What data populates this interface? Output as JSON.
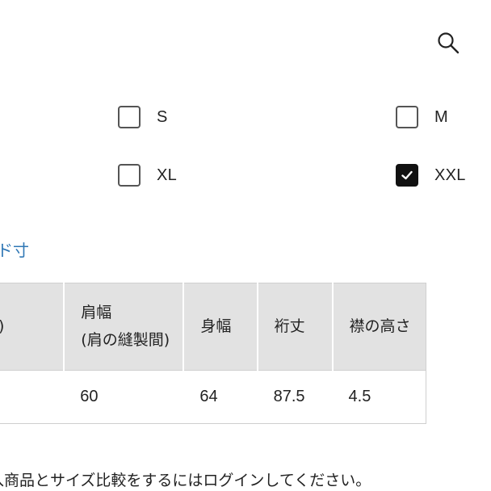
{
  "header": {
    "search_icon": "search-icon"
  },
  "size_options": [
    {
      "label": "S",
      "checked": false
    },
    {
      "label": "M",
      "checked": false
    },
    {
      "label": "XL",
      "checked": false
    },
    {
      "label": "XXL",
      "checked": true
    }
  ],
  "size_link": {
    "label": "ド寸"
  },
  "table": {
    "headers": [
      {
        "line1": "ろ身頃)",
        "line2": ""
      },
      {
        "line1": "肩幅",
        "line2": "(肩の縫製間)"
      },
      {
        "line1": "身幅",
        "line2": ""
      },
      {
        "line1": "裄丈",
        "line2": ""
      },
      {
        "line1": "襟の高さ",
        "line2": ""
      }
    ],
    "rows": [
      [
        "",
        "60",
        "64",
        "87.5",
        "4.5"
      ]
    ]
  },
  "footer": {
    "login_note": "入商品とサイズ比較をするにはログインしてください。"
  }
}
